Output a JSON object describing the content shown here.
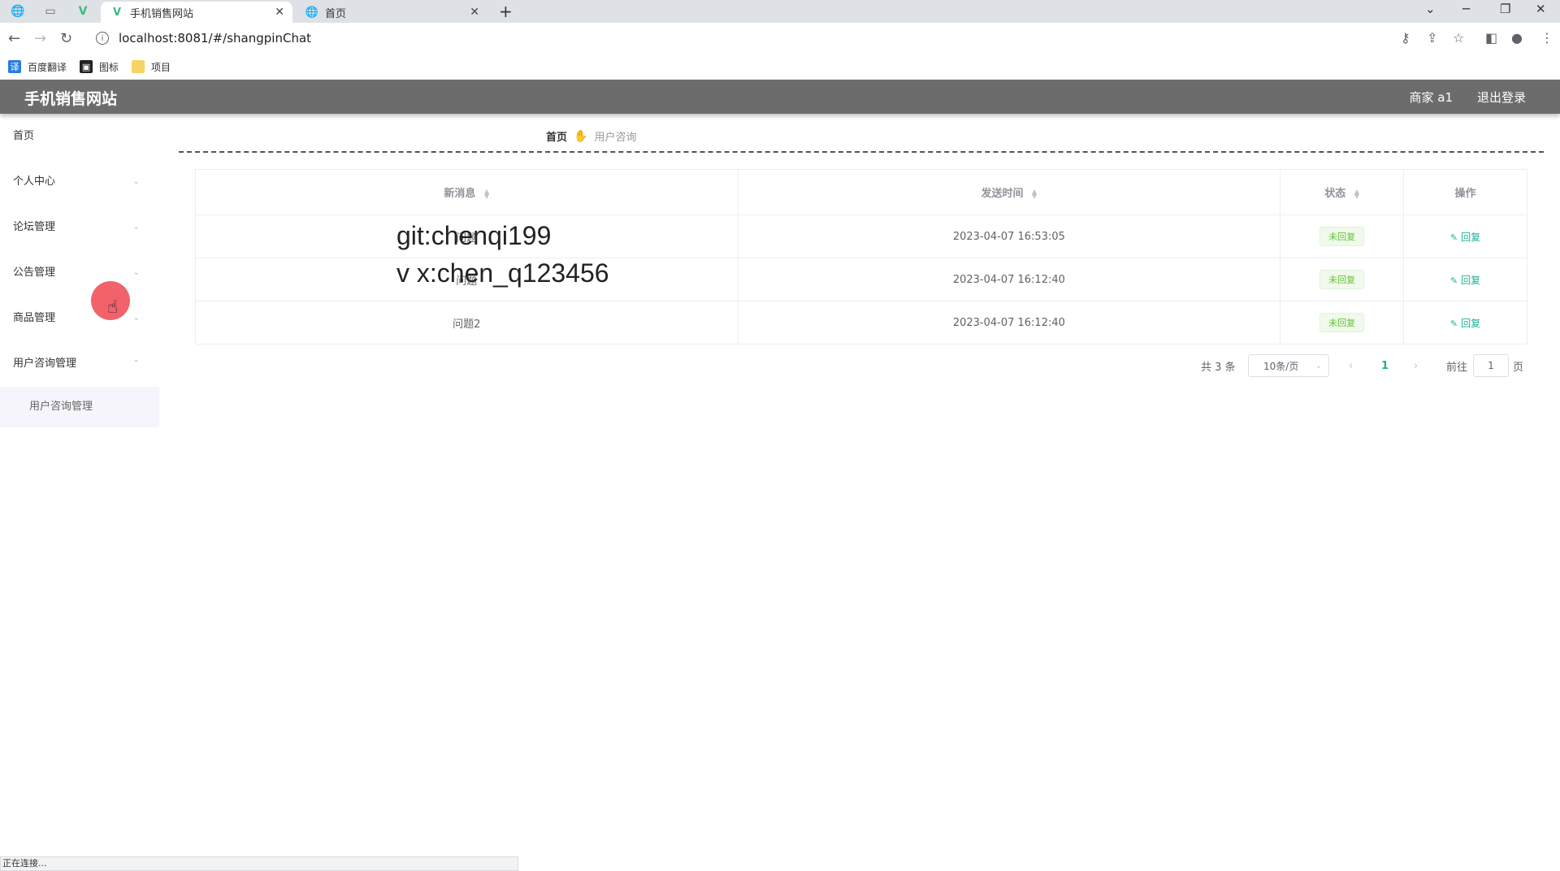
{
  "browser": {
    "tabs": [
      {
        "title": "手机销售网站",
        "active": true
      },
      {
        "title": "首页",
        "active": false
      }
    ],
    "url": "localhost:8081/#/shangpinChat",
    "bookmarks": [
      "百度翻译",
      "图标",
      "项目"
    ],
    "status_text": "正在连接..."
  },
  "header": {
    "title": "手机销售网站",
    "user": "商家 a1",
    "logout": "退出登录"
  },
  "sidebar": {
    "items": [
      {
        "label": "首页"
      },
      {
        "label": "个人中心"
      },
      {
        "label": "论坛管理"
      },
      {
        "label": "公告管理"
      },
      {
        "label": "商品管理"
      },
      {
        "label": "用户咨询管理"
      }
    ],
    "sub_item": "用户咨询管理"
  },
  "breadcrumb": {
    "home": "首页",
    "current": "用户咨询"
  },
  "table": {
    "headers": [
      "新消息",
      "发送时间",
      "状态",
      "操作"
    ],
    "rows": [
      {
        "message": "问题",
        "time": "2023-04-07 16:53:05",
        "status": "未回复",
        "action": "回复"
      },
      {
        "message": "问题",
        "time": "2023-04-07 16:12:40",
        "status": "未回复",
        "action": "回复"
      },
      {
        "message": "问题2",
        "time": "2023-04-07 16:12:40",
        "status": "未回复",
        "action": "回复"
      }
    ]
  },
  "pagination": {
    "total": "共 3 条",
    "page_size": "10条/页",
    "current_page": "1",
    "goto_label": "前往",
    "goto_value": "1",
    "page_suffix": "页"
  },
  "watermark": {
    "line1": "git:chenqi199",
    "line2": "v x:chen_q123456"
  },
  "colors": {
    "header_bg": "#6c6c6c",
    "accent": "#1ab394",
    "status_green": "#67c23a"
  }
}
